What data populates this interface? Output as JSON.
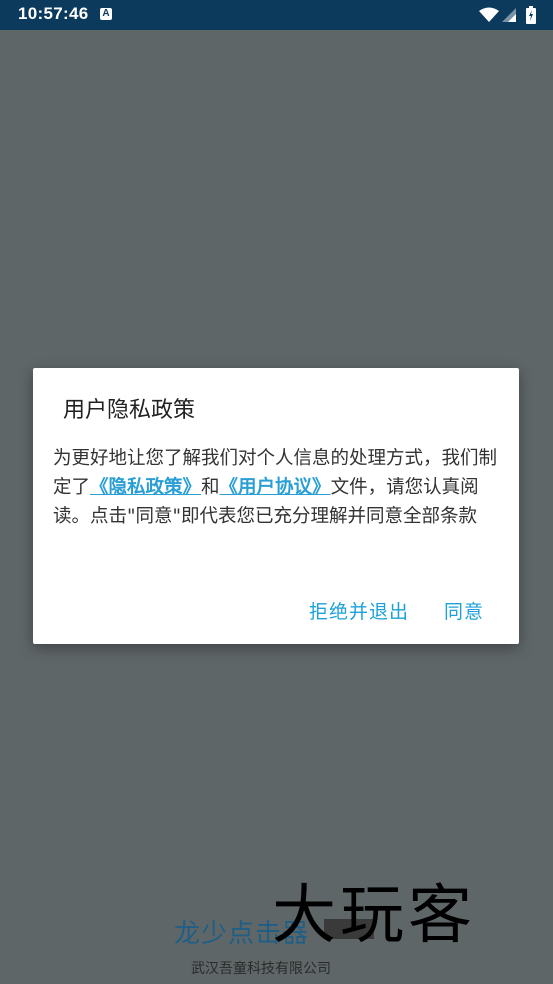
{
  "status_bar": {
    "time": "10:57:46",
    "notification_icon": "A"
  },
  "dialog": {
    "title": "用户隐私政策",
    "body_part1": "为更好地让您了解我们对个人信息的处理方式，我们制定了",
    "privacy_link": "《隐私政策》",
    "body_part2": "和",
    "user_agreement_link": "《用户协议》",
    "body_part3": "文件，请您认真阅读。点击\"同意\"即代表您已充分理解并同意全部条款",
    "reject_button": "拒绝并退出",
    "agree_button": "同意"
  },
  "footer": {
    "app_name": "龙少点击器",
    "company": "武汉吾童科技有限公司"
  },
  "watermark": "大玩客",
  "colors": {
    "status_bar": "#0b3a5c",
    "overlay_background": "#5f6668",
    "link": "#2a9fd6",
    "button": "#1da1d8",
    "app_name": "#1f5f86"
  }
}
